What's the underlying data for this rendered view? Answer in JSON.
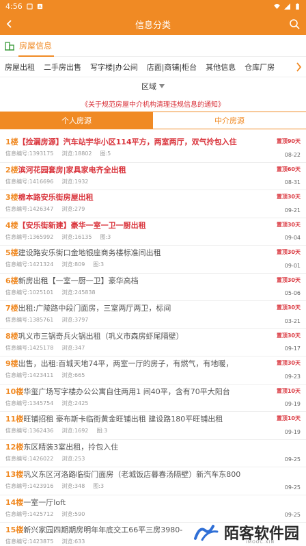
{
  "status": {
    "time": "4:56"
  },
  "appbar": {
    "title": "信息分类"
  },
  "category": {
    "label": "房屋信息"
  },
  "subtabs": [
    "房屋出租",
    "二手房出售",
    "写字楼|办公间",
    "店面|商铺|柜台",
    "其他信息",
    "仓库厂房"
  ],
  "area": {
    "label": "区域"
  },
  "notice": "《关于规范房屋中介机构清理违规信息的通知》",
  "segments": {
    "personal": "个人房源",
    "agency": "中介房源"
  },
  "items": [
    {
      "floor": "1楼",
      "title": "【捡漏房源】汽车站宇华小区114平方，两室两厅，双气拎包入住",
      "id": "信息编号:1393175",
      "views": "浏览:18802",
      "pics": "图:5",
      "badge": "置顶90天",
      "date": "08-22",
      "hot": true
    },
    {
      "floor": "2楼",
      "title": "滨河花园套房|家具家电齐全出租",
      "id": "信息编号:1416696",
      "views": "浏览:1932",
      "pics": "",
      "badge": "置顶60天",
      "date": "08-31",
      "hot": true
    },
    {
      "floor": "3楼",
      "title": "棉本路安乐街房屋出租",
      "id": "信息编号:1426347",
      "views": "浏览:279",
      "pics": "",
      "badge": "置顶30天",
      "date": "09-21",
      "hot": true
    },
    {
      "floor": "4楼",
      "title": "【安乐街新建】豪华一室一卫一厨出租",
      "id": "信息编号:1365992",
      "views": "浏览:16135",
      "pics": "图:3",
      "badge": "置顶30天",
      "date": "09-04",
      "hot": true
    },
    {
      "floor": "5楼",
      "title": "建设路安乐街口金地银座商务楼标准间出租",
      "id": "信息编号:1421324",
      "views": "浏览:809",
      "pics": "图:3",
      "badge": "置顶30天",
      "date": "09-01",
      "hot": false
    },
    {
      "floor": "6楼",
      "title": "新房出租【一室一厨一卫】豪华高档",
      "id": "信息编号:1025101",
      "views": "浏览:245838",
      "pics": "",
      "badge": "置顶30天",
      "date": "05-06",
      "hot": false
    },
    {
      "floor": "7楼",
      "title": "出租:广陵路中段门面房，三室两厅两卫，标间",
      "id": "信息编号:1385761",
      "views": "浏览:3797",
      "pics": "",
      "badge": "置顶30天",
      "date": "03-21",
      "hot": false
    },
    {
      "floor": "8楼",
      "title": "巩义市三锅奇兵火锅出租（巩义市森房虾尾隔壁）",
      "id": "信息编号:1425178",
      "views": "浏览:347",
      "pics": "",
      "badge": "置顶30天",
      "date": "09-17",
      "hot": false
    },
    {
      "floor": "9楼",
      "title": "出售，出租:百城天地74平，两室一厅的房子，有燃气，有地暖，",
      "id": "信息编号:1423411",
      "views": "浏览:665",
      "pics": "",
      "badge": "置顶30天",
      "date": "09-23",
      "hot": false
    },
    {
      "floor": "10楼",
      "title": "华玺广场写字楼办公公寓自住两用1 间40平，含有70平大阳台",
      "id": "信息编号:1345754",
      "views": "浏览:2425",
      "pics": "",
      "badge": "置顶10天",
      "date": "09-19",
      "hot": false
    },
    {
      "floor": "11楼",
      "title": "旺铺招租 豪布斯卡临街黄金旺铺出租 建设路180平旺铺出租",
      "id": "信息编号:1362436",
      "views": "浏览:1692",
      "pics": "图:3",
      "badge": "置顶10天",
      "date": "09-19",
      "hot": false
    },
    {
      "floor": "12楼",
      "title": "东区精装3室出租，拎包入住",
      "id": "信息编号:1426022",
      "views": "浏览:253",
      "pics": "",
      "badge": "",
      "date": "09-25",
      "hot": false
    },
    {
      "floor": "13楼",
      "title": "巩义东区河洛路临街门面房（老城饭店暮春汤隔壁）新汽车东800",
      "id": "信息编号:1423916",
      "views": "浏览:348",
      "pics": "图:3",
      "badge": "",
      "date": "09-25",
      "hot": false
    },
    {
      "floor": "14楼",
      "title": "一室一厅loft",
      "id": "信息编号:1425712",
      "views": "浏览:590",
      "pics": "",
      "badge": "",
      "date": "09-25",
      "hot": false
    },
    {
      "floor": "15楼",
      "title": "新兴家园四期期房明年年底交工66平三房3980-",
      "id": "信息编号:1423875",
      "views": "浏览:633",
      "pics": "",
      "badge": "",
      "date": "",
      "hot": false
    }
  ],
  "watermark": {
    "text": "陌客软件园",
    "sub": "IMOOC.XIN"
  },
  "colors": {
    "accent": "#f08a24",
    "hot": "#d9333b"
  }
}
